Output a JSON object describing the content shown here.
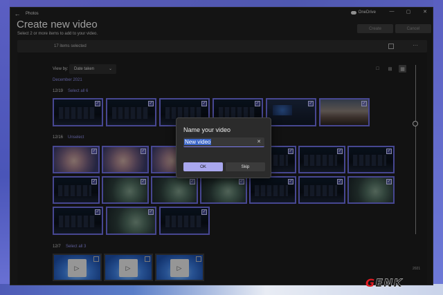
{
  "window": {
    "app_title": "Photos",
    "onedrive_label": "OneDrive",
    "heading": "Create new video",
    "subheading": "Select 2 or more items to add to your video.",
    "create_label": "Create",
    "cancel_label": "Cancel"
  },
  "selection": {
    "count_label": "17 items selected"
  },
  "gallery": {
    "view_by_label": "View by:",
    "sort_value": "Date taken",
    "month_label": "December 2021",
    "groups": [
      {
        "date": "12/19",
        "action": "Select all 6"
      },
      {
        "date": "12/16",
        "action": "Unselect"
      },
      {
        "date": "12/7",
        "action": "Select all 3"
      }
    ],
    "timeline_year": "2021"
  },
  "dialog": {
    "title": "Name your video",
    "input_value": "New video",
    "clear_glyph": "✕",
    "ok_label": "OK",
    "skip_label": "Skip"
  },
  "watermark": {
    "brand_g": "G",
    "brand_rest": "ENK"
  },
  "colors": {
    "accent": "#6e6ee0",
    "window_bg": "#202020",
    "dialog_bg": "#2b2b2b"
  }
}
